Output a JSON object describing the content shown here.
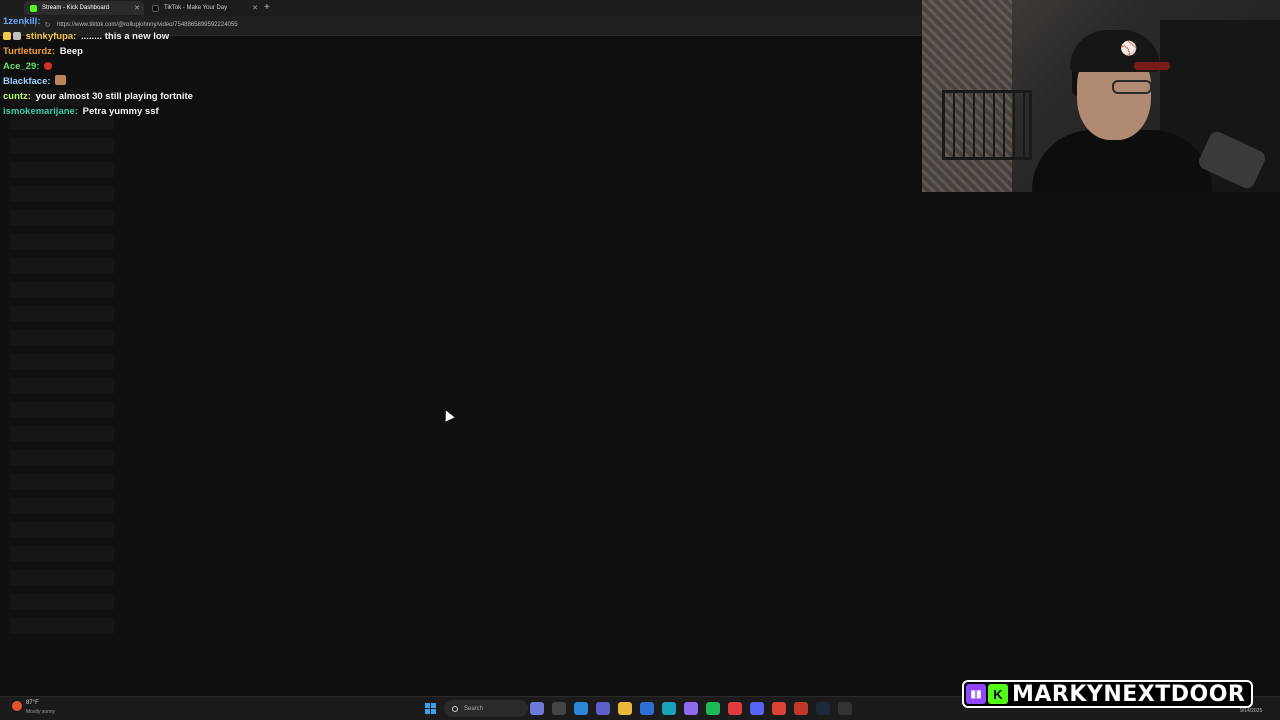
{
  "browser": {
    "tabs": [
      {
        "label": "Stream - Kick Dashboard",
        "active": true,
        "favicon_color": "#53fc18"
      },
      {
        "label": "TikTok - Make Your Day",
        "active": false,
        "favicon_color": "#111111"
      }
    ],
    "new_tab": "+",
    "url": "https://www.tiktok.com/@rollupjohnny/video/7548865899592224055"
  },
  "chat": {
    "messages": [
      {
        "user": "1zenkill:",
        "text": "",
        "color": "#6aa8ff"
      },
      {
        "user": "stinkyfupa:",
        "text": "........ this a new low",
        "color": "#f2c94c",
        "badges": [
          "crown-icon",
          "sword-icon"
        ]
      },
      {
        "user": "Turtleturdz:",
        "text": "Beep",
        "color": "#f29d38"
      },
      {
        "user": "Ace_29:",
        "text": "",
        "color": "#63e06b",
        "emote": "shield-emote"
      },
      {
        "user": "Blackface:",
        "text": "",
        "color": "#9ed1ff",
        "emote": "face-emote"
      },
      {
        "user": "cuntz:",
        "text": "your almost 30 still playing fortnite",
        "color": "#b7f36b"
      },
      {
        "user": "ismokemarijane:",
        "text": "Petra yummy ssf",
        "color": "#3ccfb0"
      }
    ]
  },
  "taskbar": {
    "weather_temp": "87°F",
    "weather_desc": "Mostly sunny",
    "search_placeholder": "Search",
    "date": "9/14/2025",
    "apps": [
      {
        "name": "file-explorer-icon",
        "color": "#6c7bd8"
      },
      {
        "name": "task-view-icon",
        "color": "#444444"
      },
      {
        "name": "copilot-icon",
        "color": "#2f86d6"
      },
      {
        "name": "teams-icon",
        "color": "#5b5fc7"
      },
      {
        "name": "folder-icon",
        "color": "#e8b83a"
      },
      {
        "name": "store-icon",
        "color": "#2a6fd6"
      },
      {
        "name": "edge-icon",
        "color": "#17a3b8"
      },
      {
        "name": "app-icon",
        "color": "#8e6cf2"
      },
      {
        "name": "spotify-icon",
        "color": "#1db954"
      },
      {
        "name": "red-app-icon",
        "color": "#e23b3b"
      },
      {
        "name": "discord-icon",
        "color": "#5865f2"
      },
      {
        "name": "chrome-icon",
        "color": "#db4437"
      },
      {
        "name": "media-icon",
        "color": "#c0392b"
      },
      {
        "name": "steam-icon",
        "color": "#1b2838"
      },
      {
        "name": "epic-icon",
        "color": "#333333"
      }
    ]
  },
  "brand": {
    "name": "MARKYNEXTDOOR",
    "twitch_color": "#9146ff",
    "kick_color": "#53fc18",
    "kick_letter": "K"
  }
}
